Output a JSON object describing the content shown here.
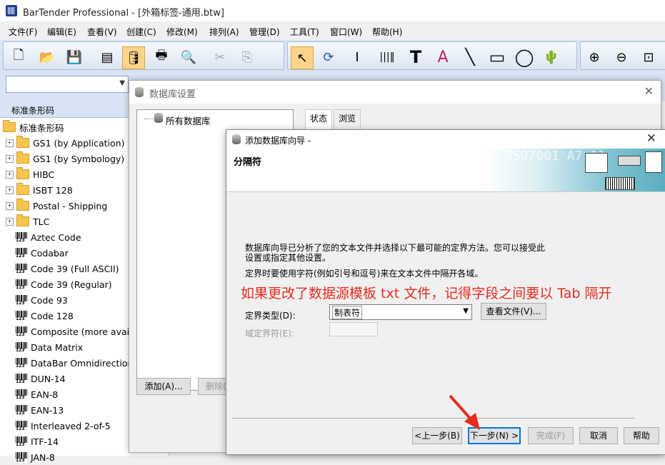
{
  "app": {
    "title": "BarTender Professional - [外箱标签-通用.btw]"
  },
  "menu": [
    "文件(F)",
    "编辑(E)",
    "查看(V)",
    "创建(C)",
    "修改(M)",
    "排列(A)",
    "管理(D)",
    "工具(T)",
    "窗口(W)",
    "帮助(H)"
  ],
  "left_panel": {
    "title": "标准条形码",
    "root": "标准条形码",
    "folders": [
      "GS1 (by Application)",
      "GS1 (by Symbology)",
      "HIBC",
      "ISBT 128",
      "Postal - Shipping",
      "TLC"
    ],
    "barcodes": [
      "Aztec Code",
      "Codabar",
      "Code 39 (Full ASCII)",
      "Code 39 (Regular)",
      "Code 93",
      "Code 128",
      "Composite (more availa",
      "Data Matrix",
      "DataBar Omnidirectional",
      "DUN-14",
      "EAN-8",
      "EAN-13",
      "Interleaved 2-of-5",
      "ITF-14",
      "JAN-8"
    ]
  },
  "db_window": {
    "title": "数据库设置",
    "tree_root": "所有数据库",
    "tabs": [
      "状态",
      "浏览"
    ],
    "add_button": "添加(A)...",
    "delete_button": "删除("
  },
  "wizard": {
    "title": "添加数据库向导 -",
    "heading": "分隔符",
    "banner_text": "5597001  A7-11",
    "description_line1": "数据库向导已分析了您的文本文件并选择以下最可能的定界方法。您可以接受此",
    "description_line2": "设置或指定其他设置。",
    "description_line3": "定界时要使用字符(例如引号和逗号)来在文本文件中隔开各域。",
    "annotation": "如果更改了数据源模板 txt 文件，记得字段之间要以 Tab 隔开",
    "delimiter_type_label": "定界类型(D):",
    "delimiter_type_value": "制表符",
    "view_file_button": "查看文件(V)...",
    "field_delimiter_label": "域定界符(E):",
    "back_button": "<上一步(B)",
    "next_button": "下一步(N) >",
    "finish_button": "完成(F)",
    "cancel_button": "取消",
    "help_button": "帮助"
  },
  "colors": {
    "annotation": "#e82c1e",
    "arrow": "#e82c1e",
    "toolbar": "#d8e4f3"
  }
}
